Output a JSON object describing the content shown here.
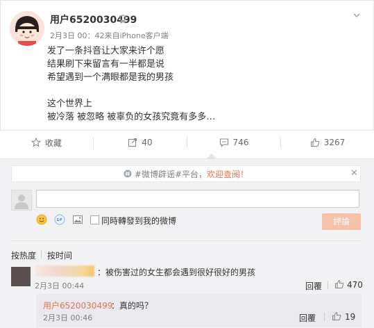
{
  "post": {
    "username": "用户6520030499",
    "verify_icon": "medal-icon",
    "meta": "2月3日 00：42来自iPhone客户端",
    "content": "发了一条抖音让大家来许个愿\n结果刷下来留言有一半都是说\n希望遇到一个满眼都是我的男孩\n\n这个世界上\n被冷落 被忽略 被辜负的女孩究竟有多多…"
  },
  "actions": {
    "favorite_label": "收藏",
    "repost_count": "40",
    "comment_count": "746",
    "like_count": "3267"
  },
  "notice": {
    "text": "#微博辟谣#平台，",
    "link": "欢迎查阅！",
    "close": "✕"
  },
  "composer": {
    "input_value": "",
    "repost_label": "同時轉發到我的微博",
    "submit_label": "評論"
  },
  "sort": {
    "hot": "按热度",
    "time": "按时间"
  },
  "comments": [
    {
      "text": "：被伤害过的女生都会遇到很好很好的男孩",
      "time": "2月3日 00:44",
      "reply_label": "回覆",
      "likes": "470",
      "replies": [
        {
          "name": "用户6520030499",
          "text": "：真的吗？",
          "time": "2月3日 00:46",
          "reply_label": "回覆",
          "likes": "19"
        }
      ]
    }
  ],
  "colors": {
    "accent": "#eb7350",
    "submit_bg": "#f7c1a8",
    "panel_bg": "#f2f2f5"
  }
}
